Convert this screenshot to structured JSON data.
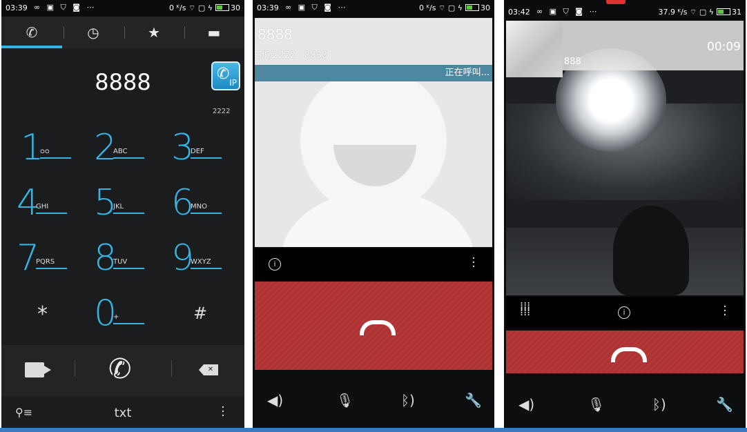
{
  "colors": {
    "accent": "#33b5e5",
    "end_call_red": "#b53838",
    "calling_bar": "#4d87a0"
  },
  "dialer": {
    "status": {
      "time": "03:39",
      "net": "0 ᴷ/s",
      "battery": "30"
    },
    "tabs": [
      {
        "name": "phone-tab",
        "icon": "phone-icon",
        "glyph": "✆"
      },
      {
        "name": "recent-tab",
        "icon": "clock-icon",
        "glyph": "◷"
      },
      {
        "name": "favorites-tab",
        "icon": "star-icon",
        "glyph": "★"
      },
      {
        "name": "contacts-tab",
        "icon": "card-icon",
        "glyph": "▬"
      }
    ],
    "number": "8888",
    "ip_label": "IP",
    "account": "2222",
    "keys": [
      {
        "d": "1",
        "l": "ᴑᴑ"
      },
      {
        "d": "2",
        "l": "ABC"
      },
      {
        "d": "3",
        "l": "DEF"
      },
      {
        "d": "4",
        "l": "GHI"
      },
      {
        "d": "5",
        "l": "JKL"
      },
      {
        "d": "6",
        "l": "MNO"
      },
      {
        "d": "7",
        "l": "PQRS"
      },
      {
        "d": "8",
        "l": "TUV"
      },
      {
        "d": "9",
        "l": "WXYZ"
      },
      {
        "d": "*",
        "l": ""
      },
      {
        "d": "0",
        "l": "+"
      },
      {
        "d": "#",
        "l": ""
      }
    ],
    "footer_text": "txt"
  },
  "calling": {
    "status": {
      "time": "03:39",
      "net": "0 ᴷ/s",
      "battery": "30"
    },
    "name": "8888",
    "sip": "SIP/2222 : 8888",
    "state": "正在呼叫..."
  },
  "video_call": {
    "status": {
      "time": "03:42",
      "net": "37.9 ᴷ/s",
      "battery": "31"
    },
    "number": "888",
    "duration": "00:09"
  }
}
